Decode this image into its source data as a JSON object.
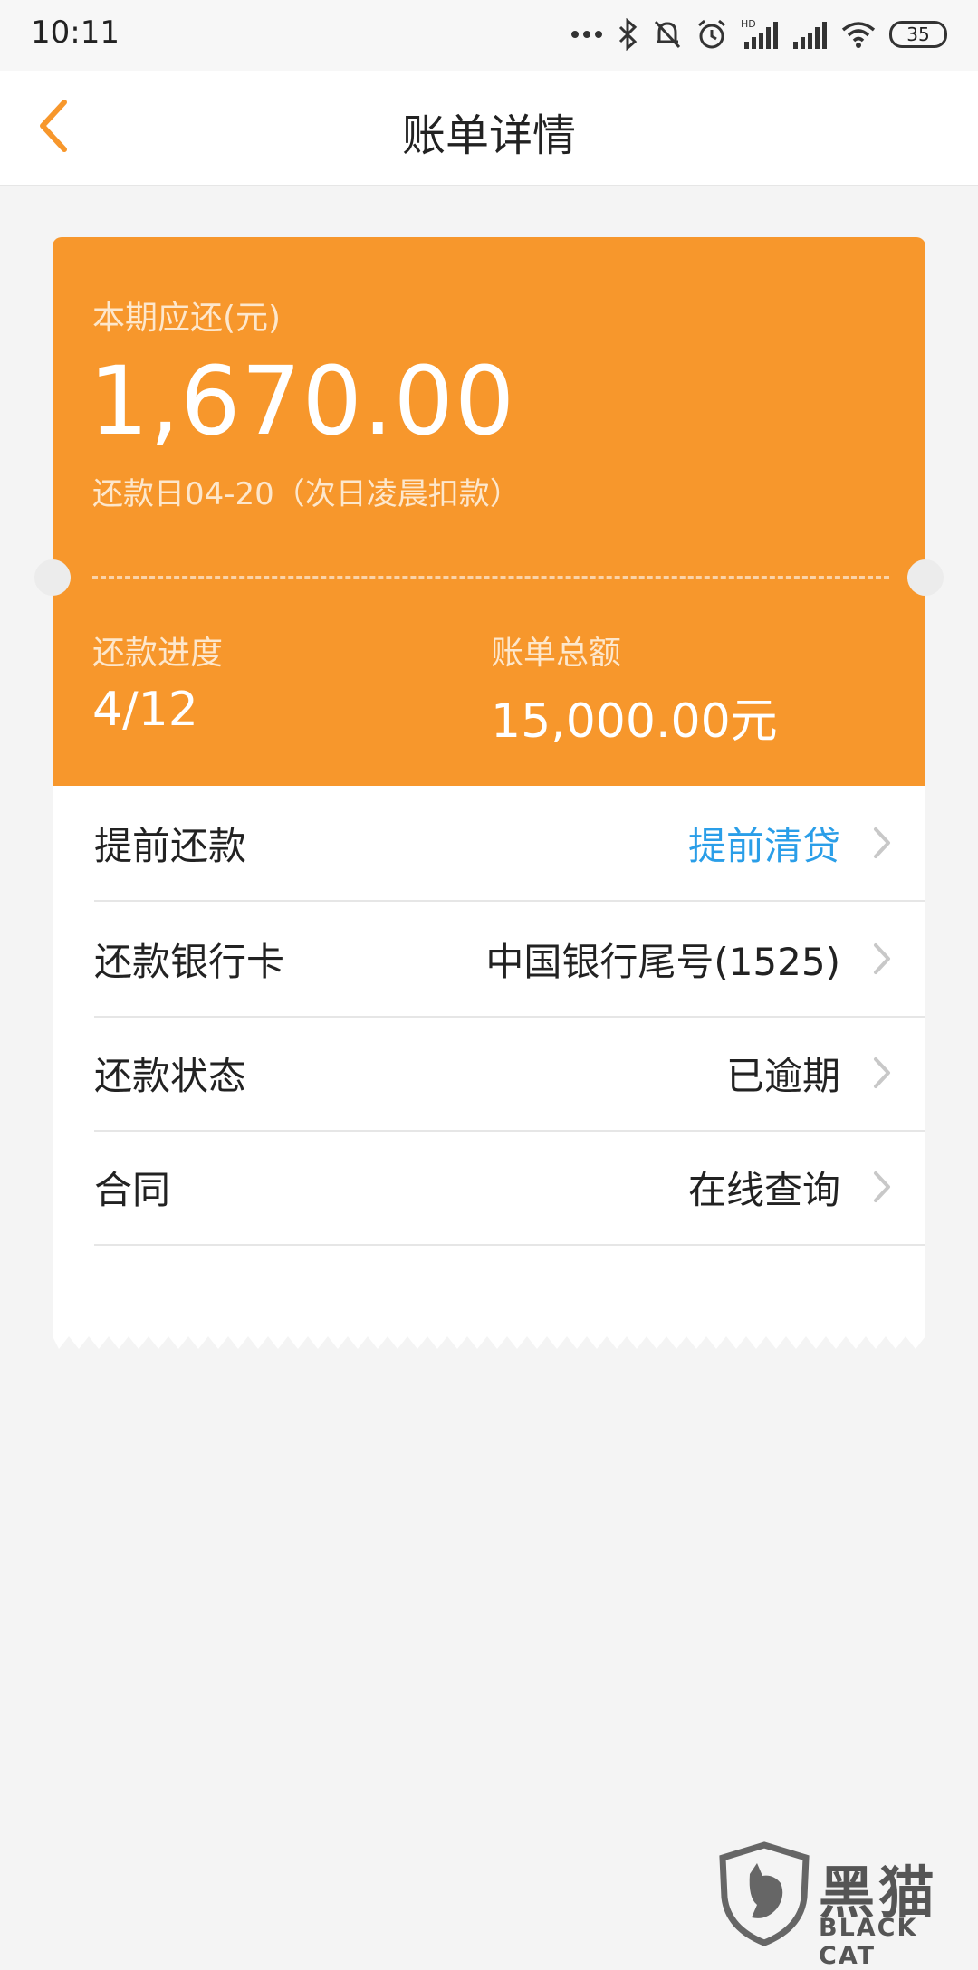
{
  "status_bar": {
    "time": "10:11",
    "battery": "35",
    "icons": [
      "more-dots-icon",
      "bluetooth-icon",
      "mute-bell-icon",
      "alarm-icon",
      "hd-signal-icon",
      "signal-icon",
      "wifi-icon",
      "battery-icon"
    ]
  },
  "nav": {
    "title": "账单详情",
    "back_icon": "chevron-left-icon",
    "accent_color": "#f7972c"
  },
  "summary": {
    "due_label": "本期应还(元)",
    "due_amount": "1,670.00",
    "due_date": "还款日04-20（次日凌晨扣款）",
    "progress_label": "还款进度",
    "progress_value": "4/12",
    "total_label": "账单总额",
    "total_value": "15,000.00元",
    "card_color": "#f7972c"
  },
  "rows": [
    {
      "label": "提前还款",
      "value": "提前清贷",
      "value_color": "#2a9ee8"
    },
    {
      "label": "还款银行卡",
      "value": "中国银行尾号(1525)"
    },
    {
      "label": "还款状态",
      "value": "已逾期"
    },
    {
      "label": "合同",
      "value": "在线查询"
    }
  ],
  "watermark": {
    "cn": "黑猫",
    "en": "BLACK CAT"
  }
}
